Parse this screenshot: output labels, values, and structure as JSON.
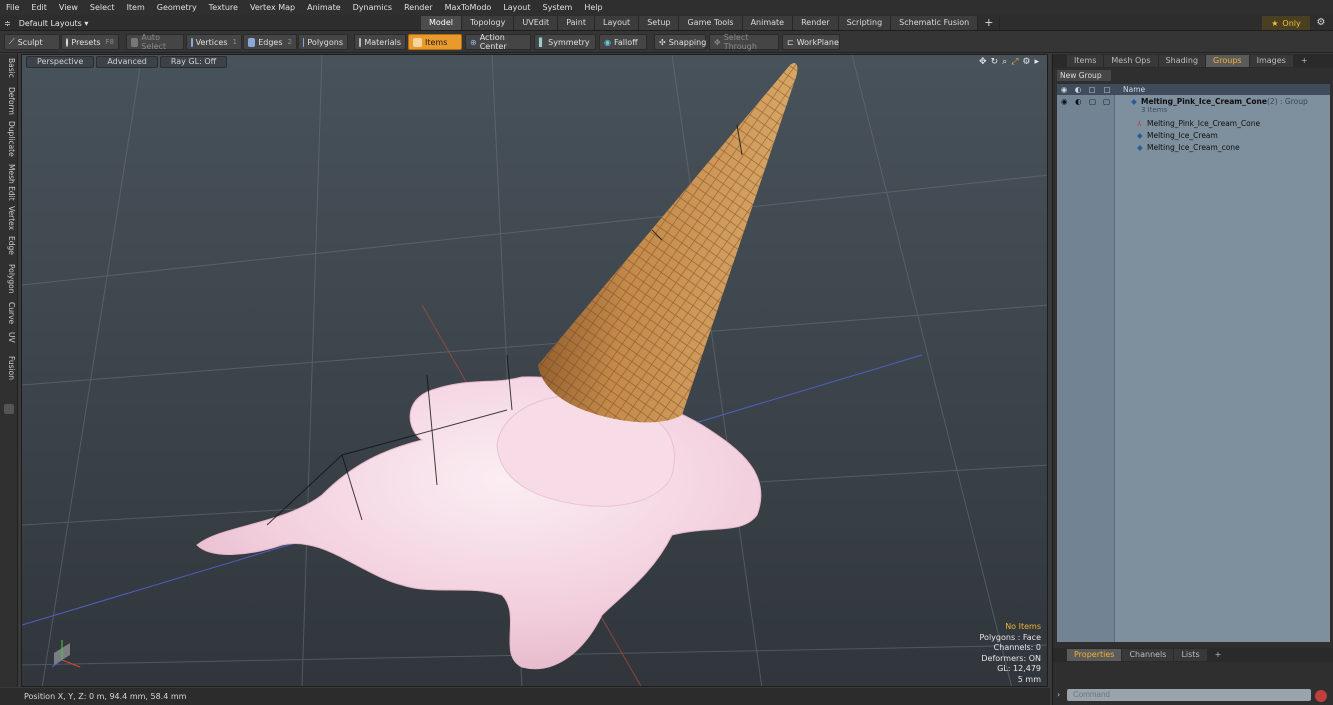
{
  "menu": [
    "File",
    "Edit",
    "View",
    "Select",
    "Item",
    "Geometry",
    "Texture",
    "Vertex Map",
    "Animate",
    "Dynamics",
    "Render",
    "MaxToModo",
    "Layout",
    "System",
    "Help"
  ],
  "layout_dropdown": "Default Layouts ▾",
  "layout_tabs": [
    "Model",
    "Topology",
    "UVEdit",
    "Paint",
    "Layout",
    "Setup",
    "Game Tools",
    "Animate",
    "Render",
    "Scripting",
    "Schematic Fusion"
  ],
  "only_label": "Only",
  "toolbar": {
    "sculpt": "Sculpt",
    "presets": "Presets",
    "presets_key": "F8",
    "auto_select": "Auto Select",
    "vertices": "Vertices",
    "vertices_key": "1",
    "edges": "Edges",
    "edges_key": "2",
    "polygons": "Polygons",
    "materials": "Materials",
    "items": "Items",
    "action_center": "Action Center",
    "symmetry": "Symmetry",
    "falloff": "Falloff",
    "snapping": "Snapping",
    "select_through": "Select Through",
    "workplane": "WorkPlane"
  },
  "left_tabs": [
    "Basic",
    "Deform",
    "Duplicate",
    "Mesh Edit",
    "Vertex",
    "Edge",
    "Polygon",
    "Curve",
    "UV",
    "Fusion"
  ],
  "viewport": {
    "view": "Perspective",
    "advanced": "Advanced",
    "raygl": "Ray GL: Off"
  },
  "stats": {
    "no_items": "No Items",
    "polygons": "Polygons : Face",
    "channels": "Channels: 0",
    "deformers": "Deformers: ON",
    "gl": "GL: 12,479",
    "scale": "5 mm"
  },
  "status": "Position X, Y, Z:  0 m, 94.4 mm, 58.4 mm",
  "right_panel": {
    "tabs": [
      "Items",
      "Mesh Ops",
      "Shading",
      "Groups",
      "Images"
    ],
    "new_group": "New Group",
    "col_name": "Name",
    "group_name": "Melting_Pink_Ice_Cream_Cone",
    "group_suffix": "(2) : Group",
    "group_items": "3 Items",
    "children": [
      "Melting_Pink_Ice_Cream_Cone",
      "Melting_Ice_Cream",
      "Melting_Ice_Cream_cone"
    ]
  },
  "bottom_tabs": [
    "Properties",
    "Channels",
    "Lists"
  ],
  "command_placeholder": "Command",
  "colors": {
    "accent": "#e89a2c",
    "groups_tab": "#f2b233",
    "tree_bg": "#7e8f9e"
  }
}
